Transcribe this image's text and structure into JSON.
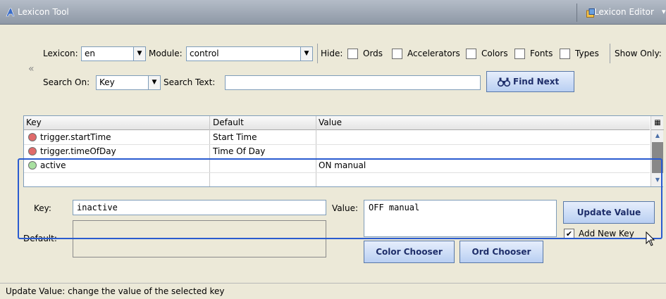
{
  "titlebar": {
    "title": "Lexicon Tool",
    "editor_label": "Lexicon Editor",
    "caret": "▾"
  },
  "toolbar": {
    "lexicon_label": "Lexicon:",
    "lexicon_value": "en",
    "module_label": "Module:",
    "module_value": "control",
    "hide_label": "Hide:",
    "hide_options": [
      "Ords",
      "Accelerators",
      "Colors",
      "Fonts",
      "Types"
    ],
    "show_only_label": "Show Only:",
    "search_on_label": "Search On:",
    "search_on_value": "Key",
    "search_text_label": "Search Text:",
    "search_text_value": "",
    "find_next_label": "Find Next",
    "collapse_glyph": "«"
  },
  "table": {
    "columns": [
      "Key",
      "Default",
      "Value"
    ],
    "rows": [
      {
        "key": "trigger.startTime",
        "default": "Start Time",
        "value": "",
        "status": "red"
      },
      {
        "key": "trigger.timeOfDay",
        "default": "Time Of Day",
        "value": "",
        "status": "red"
      },
      {
        "key": "active",
        "default": "",
        "value": "ON manual",
        "status": "green"
      }
    ]
  },
  "editor": {
    "key_label": "Key:",
    "key_value": "inactive",
    "default_label": "Default:",
    "value_label": "Value:",
    "value_value": "OFF manual",
    "update_value_label": "Update Value",
    "add_new_key_label": "Add New Key",
    "add_new_key_checked": true,
    "color_chooser_label": "Color Chooser",
    "ord_chooser_label": "Ord Chooser"
  },
  "status": {
    "text": "Update Value: change the value of the selected key"
  },
  "colors": {
    "status_red": "#e06a6a",
    "status_green": "#a8e0a0",
    "highlight": "#2a5bd0"
  }
}
